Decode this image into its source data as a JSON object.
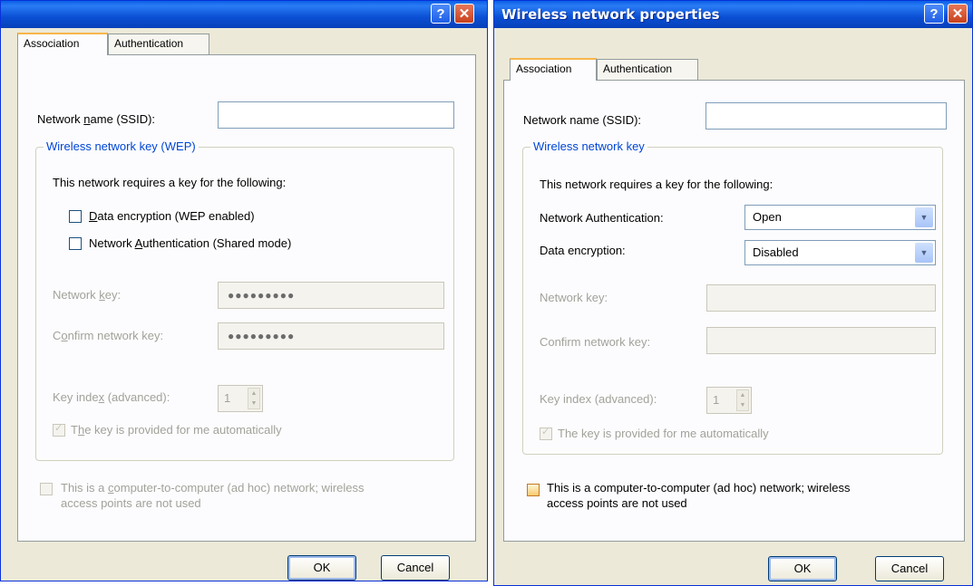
{
  "left_dialog": {
    "title": "",
    "help_glyph": "?",
    "close_glyph": "✕",
    "tabs": [
      {
        "label": "Association",
        "active": true
      },
      {
        "label": "Authentication",
        "active": false
      }
    ],
    "ssid_label_pre": "Network ",
    "ssid_label_u": "n",
    "ssid_label_post": "ame (SSID):",
    "ssid_value": "",
    "group_legend": "Wireless network key (WEP)",
    "requires_text": "This network requires a key for the following:",
    "data_enc_label_u": "D",
    "data_enc_label_rest": "ata encryption (WEP enabled)",
    "data_enc_checked": false,
    "net_auth_label_pre": "Network ",
    "net_auth_label_u": "A",
    "net_auth_label_post": "uthentication (Shared mode)",
    "net_auth_checked": false,
    "network_key_label_pre": "Network ",
    "network_key_label_u": "k",
    "network_key_label_post": "ey:",
    "network_key_value": "●●●●●●●●●",
    "confirm_key_label_pre": "C",
    "confirm_key_label_u": "o",
    "confirm_key_label_post": "nfirm network key:",
    "confirm_key_value": "●●●●●●●●●",
    "key_index_label_pre": "Key inde",
    "key_index_label_u": "x",
    "key_index_label_post": " (advanced):",
    "key_index_value": "1",
    "auto_key_label_pre": "T",
    "auto_key_label_u": "h",
    "auto_key_label_post": "e key is provided for me automatically",
    "auto_key_checked": true,
    "adhoc_label_line1_pre": "This is a ",
    "adhoc_label_line1_u": "c",
    "adhoc_label_line1_post": "omputer-to-computer (ad hoc) network; wireless",
    "adhoc_label_line2": "access points are not used",
    "adhoc_checked": false,
    "ok_label": "OK",
    "cancel_label": "Cancel"
  },
  "right_dialog": {
    "title": "Wireless network properties",
    "help_glyph": "?",
    "close_glyph": "✕",
    "tabs": [
      {
        "label": "Association",
        "active": true
      },
      {
        "label": "Authentication",
        "active": false
      }
    ],
    "ssid_label": "Network name (SSID):",
    "ssid_value": "",
    "group_legend": "Wireless network key",
    "requires_text": "This network requires a key for the following:",
    "net_auth_label": "Network Authentication:",
    "net_auth_value": "Open",
    "data_enc_label": "Data encryption:",
    "data_enc_value": "Disabled",
    "network_key_label": "Network key:",
    "network_key_value": "",
    "confirm_key_label": "Confirm network key:",
    "confirm_key_value": "",
    "key_index_label": "Key index (advanced):",
    "key_index_value": "1",
    "auto_key_label": "The key is provided for me automatically",
    "auto_key_checked": true,
    "adhoc_label_line1": "This is a computer-to-computer (ad hoc) network; wireless",
    "adhoc_label_line2": "access points are not used",
    "adhoc_checked": false,
    "ok_label": "OK",
    "cancel_label": "Cancel"
  },
  "icons": {
    "dropdown_arrow": "▼",
    "spin_up": "▲",
    "spin_down": "▼",
    "check": "✓"
  },
  "colors": {
    "title_bar": "#0a4fd4",
    "legend_text": "#0046d5",
    "dialog_bg": "#ece9d8",
    "tab_highlight": "#f7b64b"
  }
}
